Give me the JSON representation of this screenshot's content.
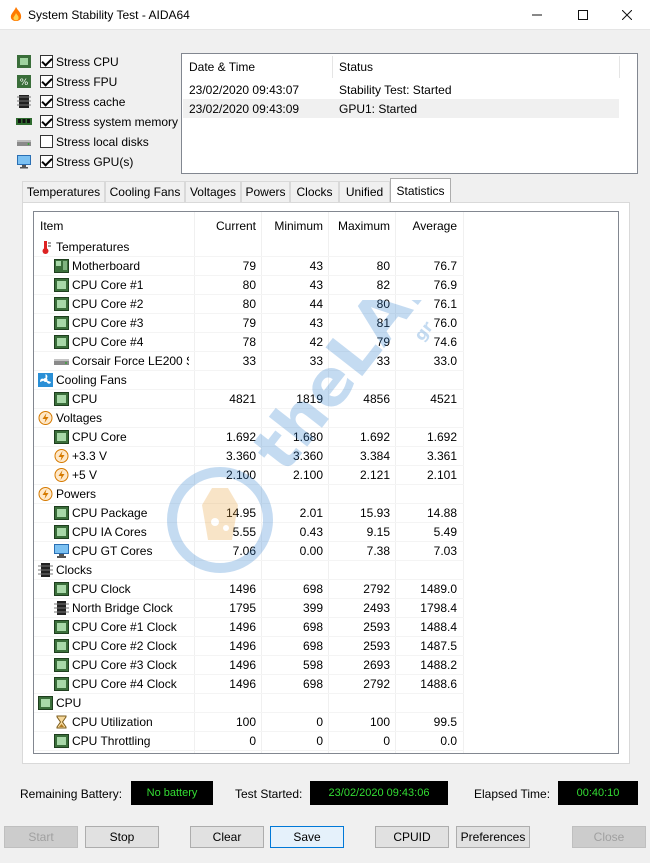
{
  "window": {
    "title": "System Stability Test - AIDA64"
  },
  "stress": [
    {
      "label": "Stress CPU",
      "checked": true,
      "icon": "cpu-chip-icon"
    },
    {
      "label": "Stress FPU",
      "checked": true,
      "icon": "fpu-percent-icon"
    },
    {
      "label": "Stress cache",
      "checked": true,
      "icon": "cache-chip-icon"
    },
    {
      "label": "Stress system memory",
      "checked": true,
      "icon": "memory-module-icon"
    },
    {
      "label": "Stress local disks",
      "checked": false,
      "icon": "disk-drive-icon"
    },
    {
      "label": "Stress GPU(s)",
      "checked": true,
      "icon": "monitor-icon"
    }
  ],
  "log": {
    "headers": {
      "datetime": "Date & Time",
      "status": "Status"
    },
    "rows": [
      {
        "datetime": "23/02/2020 09:43:07",
        "status": "Stability Test: Started"
      },
      {
        "datetime": "23/02/2020 09:43:09",
        "status": "GPU1: Started"
      }
    ]
  },
  "tabs": [
    {
      "label": "Temperatures"
    },
    {
      "label": "Cooling Fans"
    },
    {
      "label": "Voltages"
    },
    {
      "label": "Powers"
    },
    {
      "label": "Clocks"
    },
    {
      "label": "Unified"
    },
    {
      "label": "Statistics",
      "active": true
    }
  ],
  "grid": {
    "headers": {
      "item": "Item",
      "current": "Current",
      "minimum": "Minimum",
      "maximum": "Maximum",
      "average": "Average"
    },
    "rows": [
      {
        "group": true,
        "label": "Temperatures",
        "icon": "thermometer-icon"
      },
      {
        "label": "Motherboard",
        "icon": "motherboard-icon",
        "current": "79",
        "minimum": "43",
        "maximum": "80",
        "average": "76.7"
      },
      {
        "label": "CPU Core #1",
        "icon": "cpu-chip-icon",
        "current": "80",
        "minimum": "43",
        "maximum": "82",
        "average": "76.9"
      },
      {
        "label": "CPU Core #2",
        "icon": "cpu-chip-icon",
        "current": "80",
        "minimum": "44",
        "maximum": "80",
        "average": "76.1"
      },
      {
        "label": "CPU Core #3",
        "icon": "cpu-chip-icon",
        "current": "79",
        "minimum": "43",
        "maximum": "81",
        "average": "76.0"
      },
      {
        "label": "CPU Core #4",
        "icon": "cpu-chip-icon",
        "current": "78",
        "minimum": "42",
        "maximum": "79",
        "average": "74.6"
      },
      {
        "label": "Corsair Force LE200 S...",
        "icon": "disk-drive-icon",
        "current": "33",
        "minimum": "33",
        "maximum": "33",
        "average": "33.0"
      },
      {
        "group": true,
        "label": "Cooling Fans",
        "icon": "fan-icon"
      },
      {
        "label": "CPU",
        "icon": "cpu-chip-icon",
        "current": "4821",
        "minimum": "1819",
        "maximum": "4856",
        "average": "4521"
      },
      {
        "group": true,
        "label": "Voltages",
        "icon": "lightning-icon"
      },
      {
        "label": "CPU Core",
        "icon": "cpu-chip-icon",
        "current": "1.692",
        "minimum": "1.680",
        "maximum": "1.692",
        "average": "1.692"
      },
      {
        "label": "+3.3 V",
        "icon": "lightning-icon",
        "current": "3.360",
        "minimum": "3.360",
        "maximum": "3.384",
        "average": "3.361"
      },
      {
        "label": "+5 V",
        "icon": "lightning-icon",
        "current": "2.100",
        "minimum": "2.100",
        "maximum": "2.121",
        "average": "2.101"
      },
      {
        "group": true,
        "label": "Powers",
        "icon": "lightning-icon"
      },
      {
        "label": "CPU Package",
        "icon": "cpu-chip-icon",
        "current": "14.95",
        "minimum": "2.01",
        "maximum": "15.93",
        "average": "14.88"
      },
      {
        "label": "CPU IA Cores",
        "icon": "cpu-chip-icon",
        "current": "5.55",
        "minimum": "0.43",
        "maximum": "9.15",
        "average": "5.49"
      },
      {
        "label": "CPU GT Cores",
        "icon": "monitor-icon",
        "current": "7.06",
        "minimum": "0.00",
        "maximum": "7.38",
        "average": "7.03"
      },
      {
        "group": true,
        "label": "Clocks",
        "icon": "clock-chip-icon"
      },
      {
        "label": "CPU Clock",
        "icon": "cpu-chip-icon",
        "current": "1496",
        "minimum": "698",
        "maximum": "2792",
        "average": "1489.0"
      },
      {
        "label": "North Bridge Clock",
        "icon": "cache-chip-icon",
        "current": "1795",
        "minimum": "399",
        "maximum": "2493",
        "average": "1798.4"
      },
      {
        "label": "CPU Core #1 Clock",
        "icon": "cpu-chip-icon",
        "current": "1496",
        "minimum": "698",
        "maximum": "2593",
        "average": "1488.4"
      },
      {
        "label": "CPU Core #2 Clock",
        "icon": "cpu-chip-icon",
        "current": "1496",
        "minimum": "698",
        "maximum": "2593",
        "average": "1487.5"
      },
      {
        "label": "CPU Core #3 Clock",
        "icon": "cpu-chip-icon",
        "current": "1496",
        "minimum": "598",
        "maximum": "2693",
        "average": "1488.2"
      },
      {
        "label": "CPU Core #4 Clock",
        "icon": "cpu-chip-icon",
        "current": "1496",
        "minimum": "698",
        "maximum": "2792",
        "average": "1488.6"
      },
      {
        "group": true,
        "label": "CPU",
        "icon": "cpu-chip-icon"
      },
      {
        "label": "CPU Utilization",
        "icon": "hourglass-icon",
        "current": "100",
        "minimum": "0",
        "maximum": "100",
        "average": "99.5"
      },
      {
        "label": "CPU Throttling",
        "icon": "cpu-chip-icon",
        "current": "0",
        "minimum": "0",
        "maximum": "0",
        "average": "0.0"
      }
    ]
  },
  "status": {
    "battery_label": "Remaining Battery:",
    "battery_value": "No battery",
    "started_label": "Test Started:",
    "started_value": "23/02/2020 09:43:06",
    "elapsed_label": "Elapsed Time:",
    "elapsed_value": "00:40:10"
  },
  "buttons": {
    "start": "Start",
    "stop": "Stop",
    "clear": "Clear",
    "save": "Save",
    "cpuid": "CPUID",
    "preferences": "Preferences",
    "close": "Close"
  },
  "watermark": {
    "text": "theLAB",
    "suffix": "gr"
  },
  "colors": {
    "status_green": "#33dd33",
    "focus_blue": "#0078d7",
    "watermark_blue": "#2f7fcf",
    "watermark_orange": "#e9a23b"
  }
}
